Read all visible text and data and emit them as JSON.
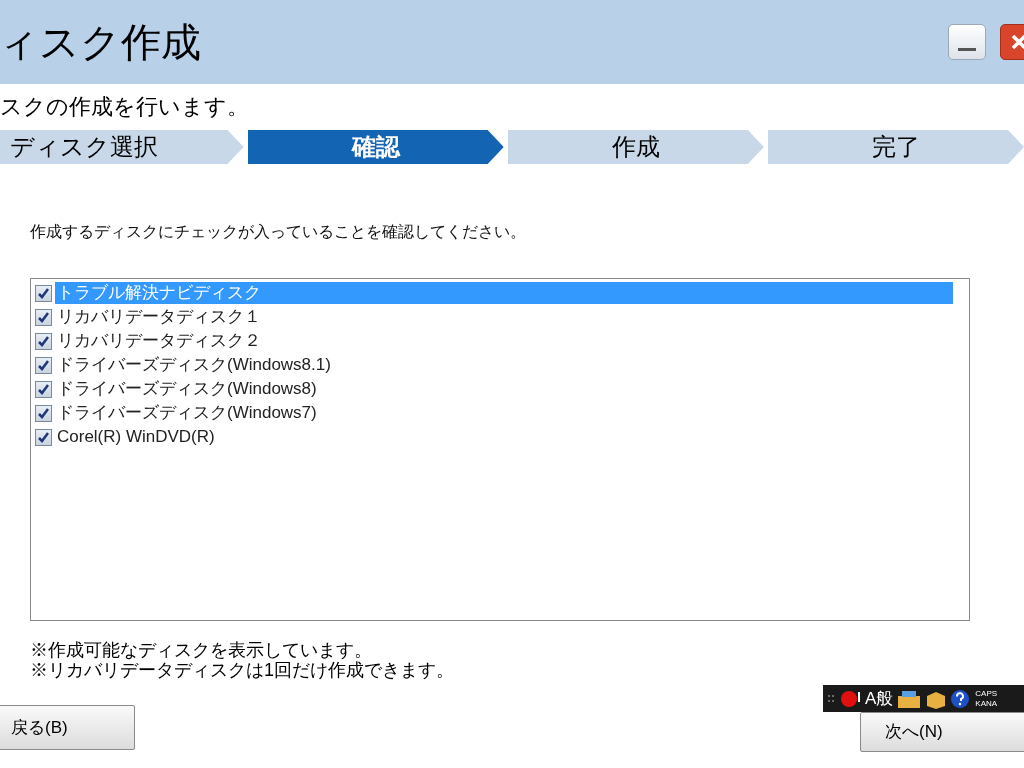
{
  "window": {
    "title": "ィスク作成"
  },
  "subtitle": "スクの作成を行います。",
  "steps": [
    {
      "label": "ディスク選択",
      "selected": false
    },
    {
      "label": "確認",
      "selected": true
    },
    {
      "label": "作成",
      "selected": false
    },
    {
      "label": "完了",
      "selected": false
    }
  ],
  "instruction": "作成するディスクにチェックが入っていることを確認してください。",
  "disks": [
    {
      "label": "トラブル解決ナビディスク",
      "checked": true,
      "selected": true
    },
    {
      "label": "リカバリデータディスク１",
      "checked": true,
      "selected": false
    },
    {
      "label": "リカバリデータディスク２",
      "checked": true,
      "selected": false
    },
    {
      "label": "ドライバーズディスク(Windows8.1)",
      "checked": true,
      "selected": false
    },
    {
      "label": "ドライバーズディスク(Windows8)",
      "checked": true,
      "selected": false
    },
    {
      "label": "ドライバーズディスク(Windows7)",
      "checked": true,
      "selected": false
    },
    {
      "label": "Corel(R) WinDVD(R)",
      "checked": true,
      "selected": false
    }
  ],
  "notes": [
    "※作成可能なディスクを表示しています。",
    "※リカバリデータディスクは1回だけ作成できます。"
  ],
  "ime_toolbar": {
    "mode": "A般",
    "caps": "CAPS",
    "kana": "KANA"
  },
  "buttons": {
    "back": "戻る(B)",
    "next": "次へ(N)"
  }
}
